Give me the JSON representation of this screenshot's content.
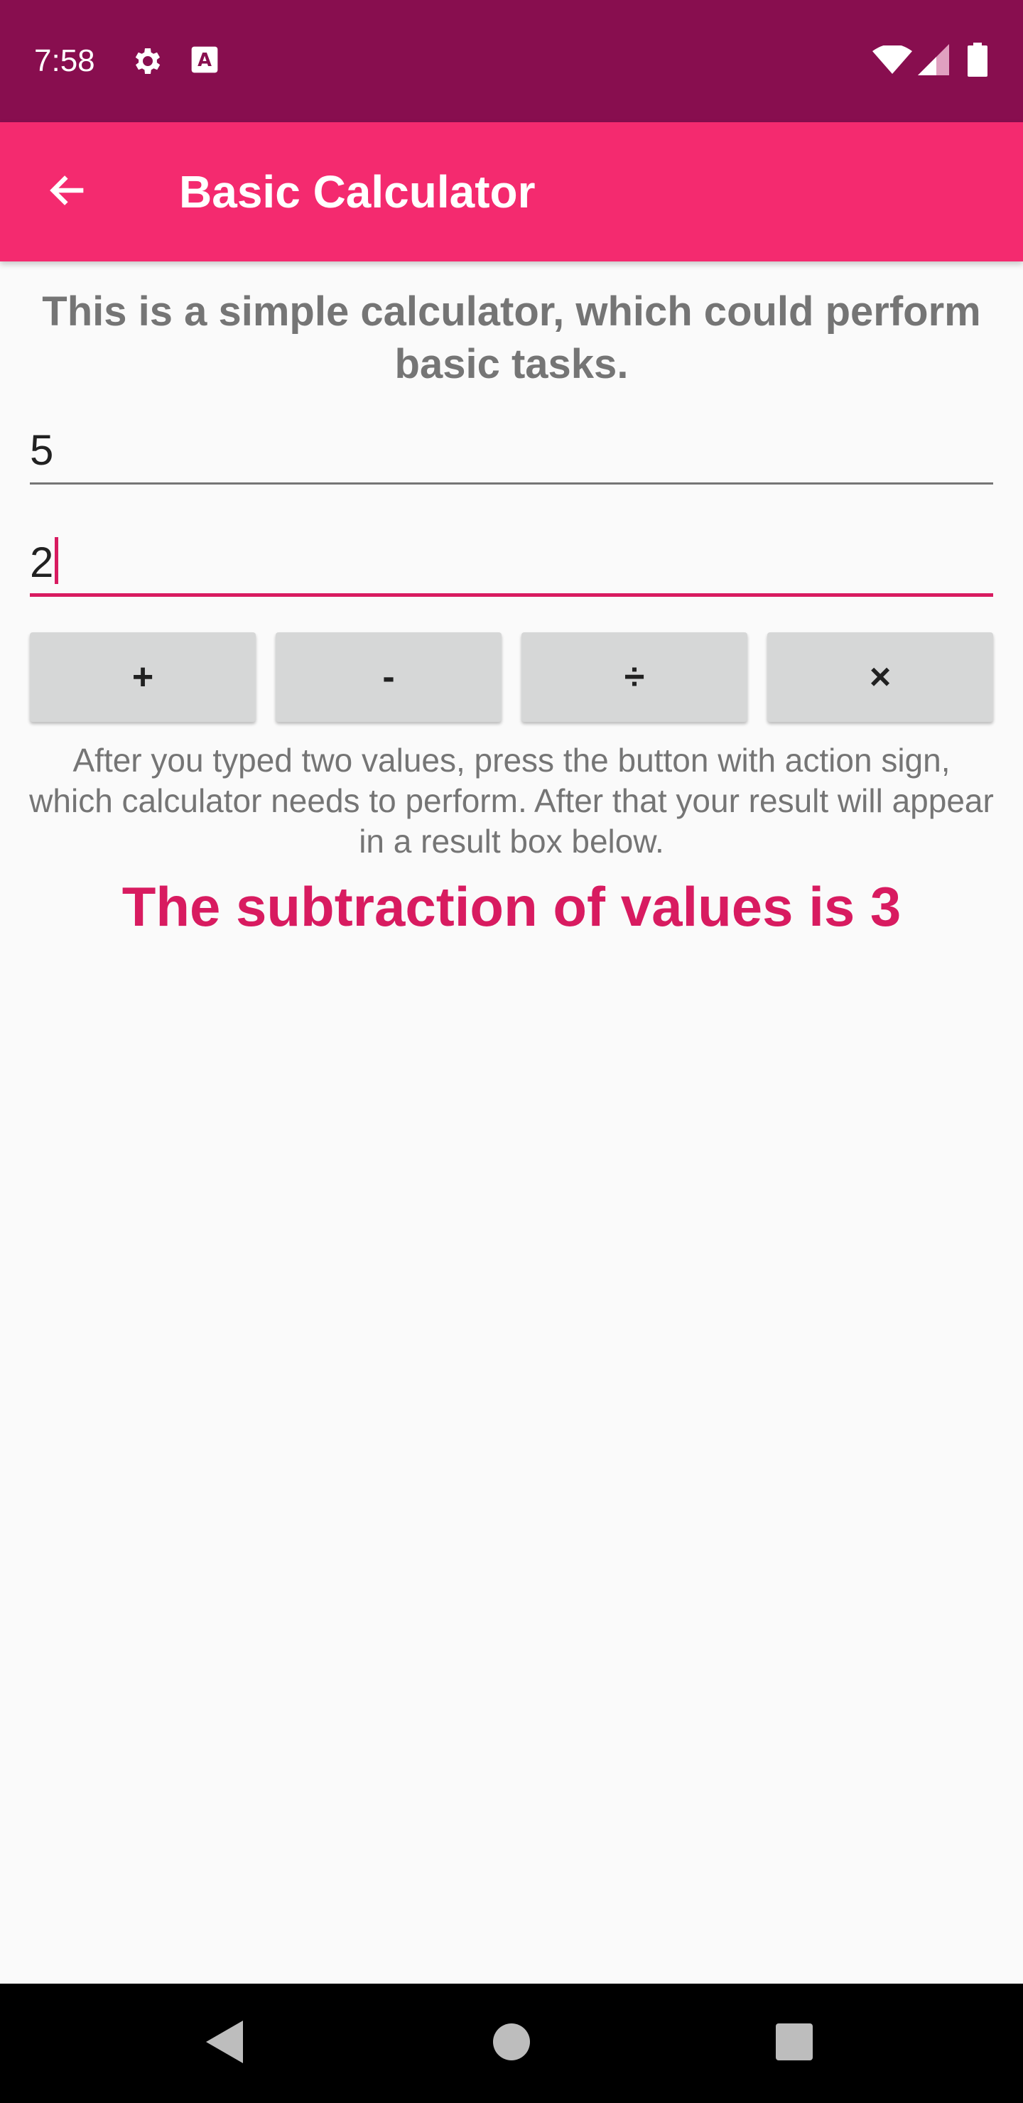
{
  "status_bar": {
    "time": "7:58",
    "icons": [
      "gear-icon",
      "keyboard-a-icon",
      "wifi-icon",
      "signal-icon",
      "battery-icon"
    ],
    "background": "#880e4f"
  },
  "app_bar": {
    "title": "Basic Calculator",
    "back_icon": "arrow-back-icon",
    "background": "#f42a6f"
  },
  "intro_text": "This is a simple calculator, which could perform basic tasks.",
  "inputs": {
    "first_value": "5",
    "second_value": "2"
  },
  "operations": [
    {
      "label": "+",
      "name": "add-button"
    },
    {
      "label": "-",
      "name": "subtract-button"
    },
    {
      "label": "÷",
      "name": "divide-button"
    },
    {
      "label": "×",
      "name": "multiply-button"
    }
  ],
  "help_text": "After you typed two values, press the button with action sign, which calculator needs to perform. After that your result will appear in a result box below.",
  "result_text": "The subtraction of values is 3",
  "colors": {
    "accent": "#d81b60",
    "button_bg": "#d6d7d7",
    "text_secondary": "#757575"
  },
  "nav_bar": {
    "icons": [
      "back-triangle-icon",
      "home-circle-icon",
      "recents-square-icon"
    ]
  }
}
